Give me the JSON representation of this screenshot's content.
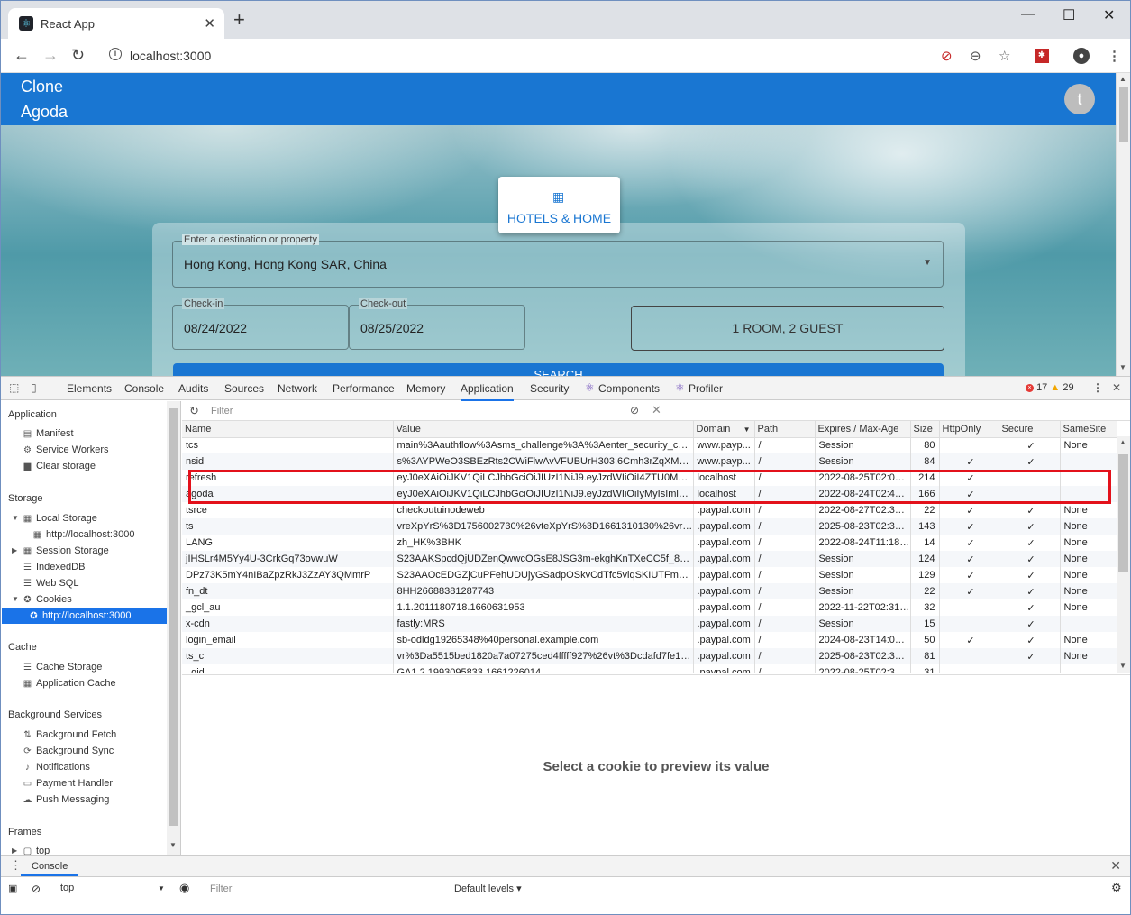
{
  "browser": {
    "tab_title": "React App",
    "new_tab": "+",
    "url": "localhost:3000",
    "minimize": "—",
    "maximize": "☐",
    "close": "✕"
  },
  "app": {
    "brand_line1": "Clone",
    "brand_line2": "Agoda",
    "avatar_letter": "t",
    "tab_label": "HOTELS & HOME",
    "destination_label": "Enter a destination or property",
    "destination_value": "Hong Kong, Hong Kong SAR, China",
    "checkin_label": "Check-in",
    "checkin_value": "08/24/2022",
    "checkout_label": "Check-out",
    "checkout_value": "08/25/2022",
    "guests": "1 ROOM, 2 GUEST",
    "search": "SEARCH"
  },
  "devtools": {
    "tabs": [
      "Elements",
      "Console",
      "Audits",
      "Sources",
      "Network",
      "Performance",
      "Memory",
      "Application",
      "Security",
      "Components",
      "Profiler"
    ],
    "active_tab": "Application",
    "errors": "17",
    "warnings": "29",
    "sidebar": {
      "application_header": "Application",
      "application_items": [
        "Manifest",
        "Service Workers",
        "Clear storage"
      ],
      "storage_header": "Storage",
      "local_storage": "Local Storage",
      "local_storage_child": "http://localhost:3000",
      "session_storage": "Session Storage",
      "indexeddb": "IndexedDB",
      "websql": "Web SQL",
      "cookies": "Cookies",
      "cookies_child": "http://localhost:3000",
      "cache_header": "Cache",
      "cache_items": [
        "Cache Storage",
        "Application Cache"
      ],
      "bg_header": "Background Services",
      "bg_items": [
        "Background Fetch",
        "Background Sync",
        "Notifications",
        "Payment Handler",
        "Push Messaging"
      ],
      "frames_header": "Frames",
      "frames_top": "top"
    },
    "filter_placeholder": "Filter",
    "columns": [
      "Name",
      "Value",
      "Domain",
      "Path",
      "Expires / Max-Age",
      "Size",
      "HttpOnly",
      "Secure",
      "SameSite"
    ],
    "cookies": [
      {
        "name": "tcs",
        "value": "main%3Aauthflow%3Asms_challenge%3A%3Aenter_security_code...",
        "domain": "www.payp...",
        "path": "/",
        "expires": "Session",
        "size": "80",
        "httponly": "",
        "secure": "✓",
        "samesite": "None"
      },
      {
        "name": "nsid",
        "value": "s%3AYPWeO3SBEzRts2CWiFlwAvVFUBUrH303.6Cmh3rZqXMOrQK...",
        "domain": "www.payp...",
        "path": "/",
        "expires": "Session",
        "size": "84",
        "httponly": "✓",
        "secure": "✓",
        "samesite": ""
      },
      {
        "name": "refresh",
        "value": "eyJ0eXAiOiJKV1QiLCJhbGciOiJIUzI1NiJ9.eyJzdWIiOiI4ZTU0MDBhN...",
        "domain": "localhost",
        "path": "/",
        "expires": "2022-08-25T02:03:...",
        "size": "214",
        "httponly": "✓",
        "secure": "",
        "samesite": ""
      },
      {
        "name": "agoda",
        "value": "eyJ0eXAiOiJKV1QiLCJhbGciOiJIUzI1NiJ9.eyJzdWIiOiIyMyIsImlzcyI6I...",
        "domain": "localhost",
        "path": "/",
        "expires": "2022-08-24T02:44:...",
        "size": "166",
        "httponly": "✓",
        "secure": "",
        "samesite": ""
      },
      {
        "name": "tsrce",
        "value": "checkoutuinodeweb",
        "domain": ".paypal.com",
        "path": "/",
        "expires": "2022-08-27T02:32:...",
        "size": "22",
        "httponly": "✓",
        "secure": "✓",
        "samesite": "None"
      },
      {
        "name": "ts",
        "value": "vreXpYrS%3D1756002730%26vteXpYrS%3D1661310130%26vr%3...",
        "domain": ".paypal.com",
        "path": "/",
        "expires": "2025-08-23T02:32:...",
        "size": "143",
        "httponly": "✓",
        "secure": "✓",
        "samesite": "None"
      },
      {
        "name": "LANG",
        "value": "zh_HK%3BHK",
        "domain": ".paypal.com",
        "path": "/",
        "expires": "2022-08-24T11:18:...",
        "size": "14",
        "httponly": "✓",
        "secure": "✓",
        "samesite": "None"
      },
      {
        "name": "jIHSLr4M5Yy4U-3CrkGq73ovwuW",
        "value": "S23AAKSpcdQjUDZenQwwcOGsE8JSG3m-ekghKnTXeCC5f_8-tP_g...",
        "domain": ".paypal.com",
        "path": "/",
        "expires": "Session",
        "size": "124",
        "httponly": "✓",
        "secure": "✓",
        "samesite": "None"
      },
      {
        "name": "DPz73K5mY4nIBaZpzRkJ3ZzAY3QMmrP",
        "value": "S23AAOcEDGZjCuPFehUDUjyGSadpOSkvCdTfc5viqSKIUTFmsrv0O...",
        "domain": ".paypal.com",
        "path": "/",
        "expires": "Session",
        "size": "129",
        "httponly": "✓",
        "secure": "✓",
        "samesite": "None"
      },
      {
        "name": "fn_dt",
        "value": "8HH26688381287743",
        "domain": ".paypal.com",
        "path": "/",
        "expires": "Session",
        "size": "22",
        "httponly": "✓",
        "secure": "✓",
        "samesite": "None"
      },
      {
        "name": "_gcl_au",
        "value": "1.1.2011180718.1660631953",
        "domain": ".paypal.com",
        "path": "/",
        "expires": "2022-11-22T02:31:...",
        "size": "32",
        "httponly": "",
        "secure": "✓",
        "samesite": "None"
      },
      {
        "name": "x-cdn",
        "value": "fastly:MRS",
        "domain": ".paypal.com",
        "path": "/",
        "expires": "Session",
        "size": "15",
        "httponly": "",
        "secure": "✓",
        "samesite": ""
      },
      {
        "name": "login_email",
        "value": "sb-odldg19265348%40personal.example.com",
        "domain": ".paypal.com",
        "path": "/",
        "expires": "2024-08-23T14:09:...",
        "size": "50",
        "httponly": "✓",
        "secure": "✓",
        "samesite": "None"
      },
      {
        "name": "ts_c",
        "value": "vr%3Da5515bed1820a7a07275ced4fffff927%26vt%3Dcdafd7fe182...",
        "domain": ".paypal.com",
        "path": "/",
        "expires": "2025-08-23T02:32:...",
        "size": "81",
        "httponly": "",
        "secure": "✓",
        "samesite": "None"
      },
      {
        "name": "_gid",
        "value": "GA1.2.1993095833.1661226014",
        "domain": ".paypal.com",
        "path": "/",
        "expires": "2022-08-25T02:31:...",
        "size": "31",
        "httponly": "",
        "secure": "",
        "samesite": ""
      }
    ],
    "preview_text": "Select a cookie to preview its value",
    "drawer": {
      "tab": "Console",
      "context": "top",
      "filter_placeholder": "Filter",
      "levels": "Default levels ▾"
    }
  }
}
